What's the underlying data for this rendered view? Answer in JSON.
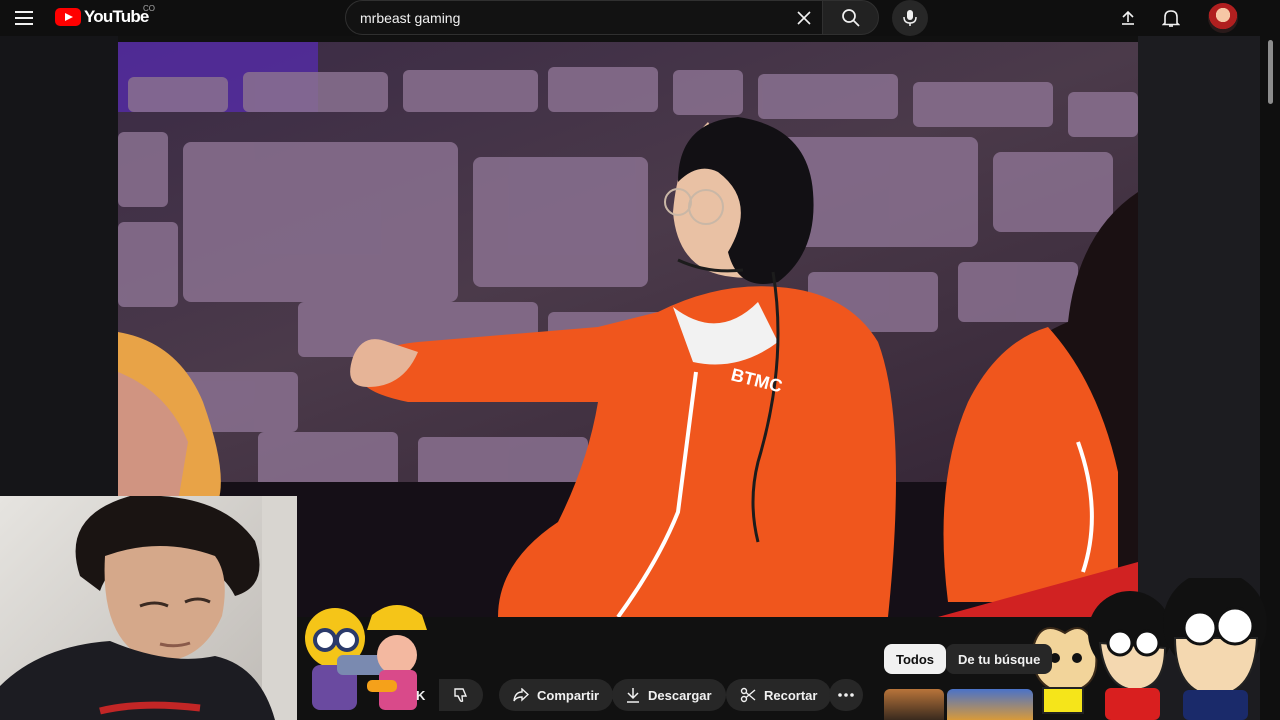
{
  "header": {
    "logo_text": "YouTube",
    "region_code": "CO",
    "search_value": "mrbeast gaming"
  },
  "video": {
    "jersey_text": "BTMC"
  },
  "actions": {
    "like_count": "K",
    "share_label": "Compartir",
    "download_label": "Descargar",
    "clip_label": "Recortar"
  },
  "chips": {
    "all_label": "Todos",
    "search_chip_label": "De tu búsque"
  },
  "colors": {
    "accent": "#ff0000",
    "background": "#0f0f0f",
    "chip_selected": "#f1f1f1",
    "pill": "#272727",
    "jumpsuit": "#f0561d"
  }
}
